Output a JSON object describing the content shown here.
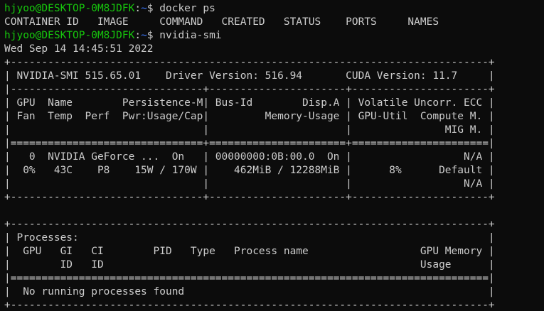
{
  "colors": {
    "background": "#0c0c0c",
    "foreground": "#cccccc",
    "prompt_user": "#16c60c",
    "prompt_path": "#3b78ff"
  },
  "prompt": {
    "user_host": "hjyoo@DESKTOP-0M8JDFK",
    "sep": ":",
    "path": "~",
    "symbol": "$ "
  },
  "commands": {
    "first": "docker ps",
    "second": "nvidia-smi"
  },
  "docker_ps": {
    "header": "CONTAINER ID   IMAGE     COMMAND   CREATED   STATUS    PORTS     NAMES"
  },
  "nvidia_smi": {
    "timestamp": "Wed Sep 14 14:45:51 2022",
    "lines": [
      "+-----------------------------------------------------------------------------+",
      "| NVIDIA-SMI 515.65.01    Driver Version: 516.94       CUDA Version: 11.7     |",
      "|-------------------------------+----------------------+----------------------+",
      "| GPU  Name        Persistence-M| Bus-Id        Disp.A | Volatile Uncorr. ECC |",
      "| Fan  Temp  Perf  Pwr:Usage/Cap|         Memory-Usage | GPU-Util  Compute M. |",
      "|                               |                      |               MIG M. |",
      "|===============================+======================+======================|",
      "|   0  NVIDIA GeForce ...  On   | 00000000:0B:00.0  On |                  N/A |",
      "|  0%   43C    P8    15W / 170W |    462MiB / 12288MiB |      8%      Default |",
      "|                               |                      |                  N/A |",
      "+-------------------------------+----------------------+----------------------+",
      "",
      "+-----------------------------------------------------------------------------+",
      "| Processes:                                                                  |",
      "|  GPU   GI   CI        PID   Type   Process name                  GPU Memory |",
      "|        ID   ID                                                   Usage      |",
      "|=============================================================================|",
      "|  No running processes found                                                 |",
      "+-----------------------------------------------------------------------------+"
    ]
  }
}
